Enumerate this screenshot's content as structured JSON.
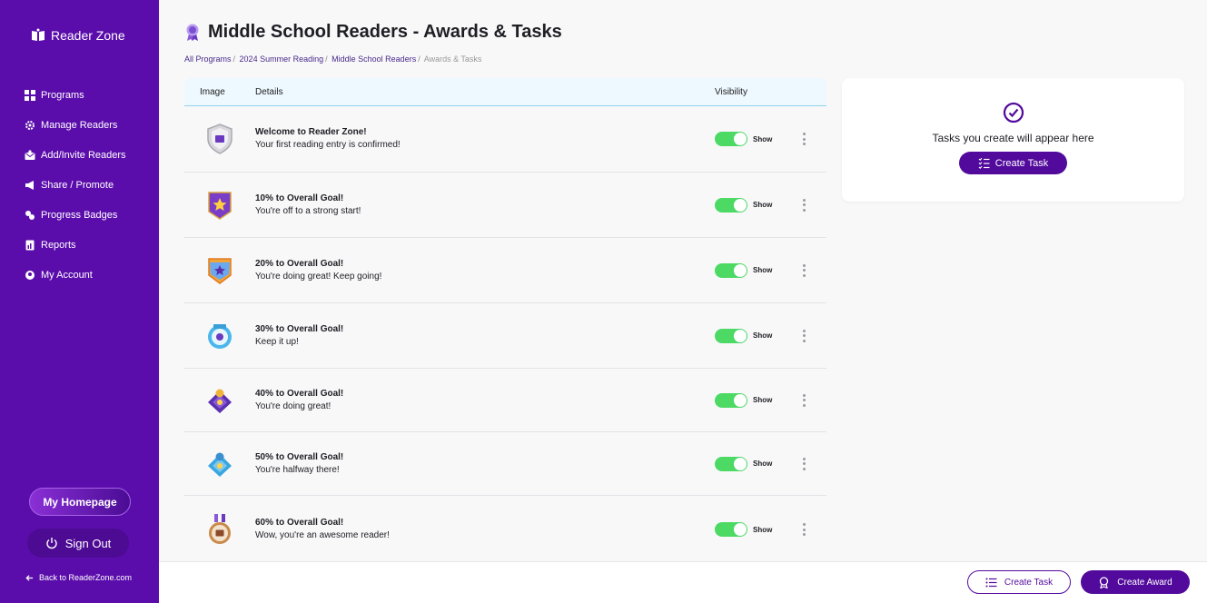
{
  "sidebar": {
    "logo_text": "Reader Zone",
    "items": [
      {
        "label": "Programs",
        "icon": "grid-icon"
      },
      {
        "label": "Manage Readers",
        "icon": "gear-icon"
      },
      {
        "label": "Add/Invite Readers",
        "icon": "envelope-icon"
      },
      {
        "label": "Share / Promote",
        "icon": "megaphone-icon"
      },
      {
        "label": "Progress Badges",
        "icon": "badges-icon"
      },
      {
        "label": "Reports",
        "icon": "report-icon"
      },
      {
        "label": "My Account",
        "icon": "account-gear-icon"
      }
    ],
    "homepage_label": "My Homepage",
    "signout_label": "Sign Out",
    "back_label": "Back to ReaderZone.com"
  },
  "header": {
    "title": "Middle School Readers - Awards & Tasks",
    "breadcrumb": [
      "All Programs",
      "2024 Summer Reading",
      "Middle School Readers",
      "Awards & Tasks"
    ]
  },
  "table": {
    "columns": {
      "image": "Image",
      "details": "Details",
      "visibility": "Visibility"
    },
    "rows": [
      {
        "title": "Welcome to Reader Zone!",
        "subtitle": "Your first reading entry is confirmed!",
        "visibility": "Show",
        "enabled": true,
        "icon": "shield-book-badge-icon"
      },
      {
        "title": "10% to Overall Goal!",
        "subtitle": "You're off to a strong start!",
        "visibility": "Show",
        "enabled": true,
        "icon": "purple-star-shield-icon"
      },
      {
        "title": "20% to Overall Goal!",
        "subtitle": "You're doing great! Keep going!",
        "visibility": "Show",
        "enabled": true,
        "icon": "orange-star-shield-icon"
      },
      {
        "title": "30% to Overall Goal!",
        "subtitle": "Keep it up!",
        "visibility": "Show",
        "enabled": true,
        "icon": "blue-round-badge-icon"
      },
      {
        "title": "40% to Overall Goal!",
        "subtitle": "You're doing great!",
        "visibility": "Show",
        "enabled": true,
        "icon": "purple-diamond-badge-icon"
      },
      {
        "title": "50% to Overall Goal!",
        "subtitle": "You're halfway there!",
        "visibility": "Show",
        "enabled": true,
        "icon": "blue-diamond-badge-icon"
      },
      {
        "title": "60% to Overall Goal!",
        "subtitle": "Wow, you're an awesome reader!",
        "visibility": "Show",
        "enabled": true,
        "icon": "bronze-medal-icon"
      }
    ]
  },
  "tasks_panel": {
    "message": "Tasks you create will appear here",
    "button_label": "Create Task"
  },
  "footer": {
    "create_task_label": "Create Task",
    "create_award_label": "Create Award"
  },
  "colors": {
    "sidebar_bg": "#5b0dab",
    "primary": "#520a9c",
    "toggle_on": "#4cd964",
    "header_row_bg": "#eef8ff"
  }
}
